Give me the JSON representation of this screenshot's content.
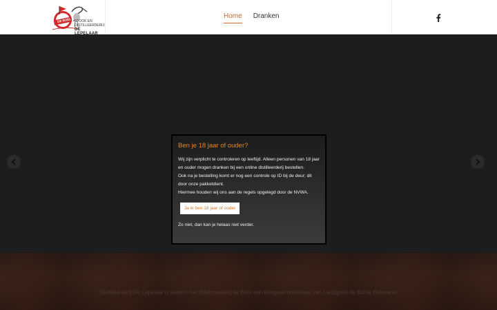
{
  "header": {
    "logo": {
      "alt_text_small": "STOOK EN DISTILLEERDERIJ",
      "alt_text_big": "DE LEPELAAR",
      "badge": "DE BOEL"
    },
    "nav": [
      {
        "label": "Home",
        "active": true
      },
      {
        "label": "Dranken",
        "active": false
      }
    ],
    "social": {
      "facebook_icon": "facebook-icon"
    }
  },
  "slider": {
    "prev_icon": "chevron-left-icon",
    "next_icon": "chevron-right-icon"
  },
  "modal": {
    "title": "Ben je 18 jaar of ouder?",
    "line1": "Wij zijn verplicht te controleren op leeftijd. Alleen personen van 18 jaar en ouder mogen dranken bij een online distilleerderij bestellen.",
    "line2": "Ook na je bestelling komt er nog een controle op ID bij de deur; dit door onze pakketdient.",
    "line3": "Hiermee houden wij ons aan de regels opgelegd door de NVWA.",
    "confirm_label": "Ja ik ben 18 jaar of ouder",
    "decline_text": "Zo niet, dan kan je helaas niet verder."
  },
  "footer": {
    "text": "Distilleerderij De Lepelaar is samen met Bierbrouwerij de Boel een integraal onderdeel van Landgoed de Bunte Belevenis"
  },
  "colors": {
    "accent": "#c4682a",
    "modal_title": "#e2862e"
  }
}
